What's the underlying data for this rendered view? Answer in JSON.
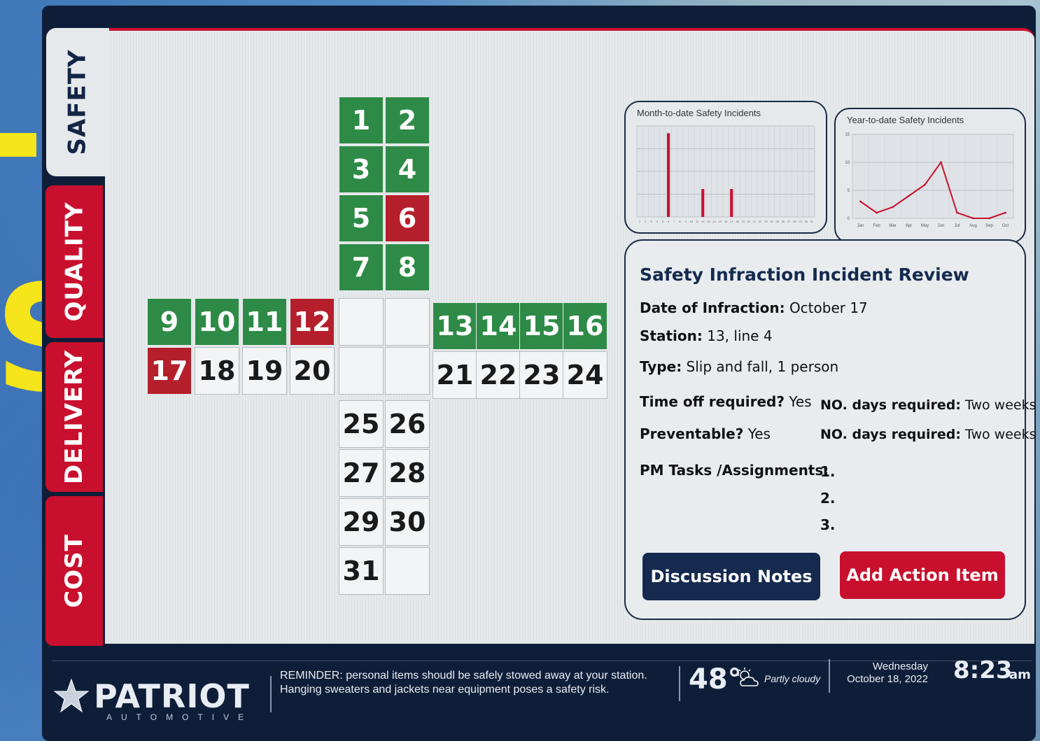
{
  "tabs": [
    {
      "label": "SAFETY",
      "active": true
    },
    {
      "label": "QUALITY",
      "active": false
    },
    {
      "label": "DELIVERY",
      "active": false
    },
    {
      "label": "COST",
      "active": false
    }
  ],
  "overlay": {
    "letter": "S"
  },
  "calendar": {
    "days": [
      {
        "n": "1",
        "status": "green"
      },
      {
        "n": "2",
        "status": "green"
      },
      {
        "n": "3",
        "status": "green"
      },
      {
        "n": "4",
        "status": "green"
      },
      {
        "n": "5",
        "status": "green"
      },
      {
        "n": "6",
        "status": "red"
      },
      {
        "n": "7",
        "status": "green"
      },
      {
        "n": "8",
        "status": "green"
      },
      {
        "n": "9",
        "status": "green"
      },
      {
        "n": "10",
        "status": "green"
      },
      {
        "n": "11",
        "status": "green"
      },
      {
        "n": "12",
        "status": "red"
      },
      {
        "n": "13",
        "status": "green"
      },
      {
        "n": "14",
        "status": "green"
      },
      {
        "n": "15",
        "status": "green"
      },
      {
        "n": "16",
        "status": "green"
      },
      {
        "n": "17",
        "status": "red"
      },
      {
        "n": "18",
        "status": "none"
      },
      {
        "n": "19",
        "status": "none"
      },
      {
        "n": "20",
        "status": "none"
      },
      {
        "n": "21",
        "status": "none"
      },
      {
        "n": "22",
        "status": "none"
      },
      {
        "n": "23",
        "status": "none"
      },
      {
        "n": "24",
        "status": "none"
      },
      {
        "n": "25",
        "status": "none"
      },
      {
        "n": "26",
        "status": "none"
      },
      {
        "n": "27",
        "status": "none"
      },
      {
        "n": "28",
        "status": "none"
      },
      {
        "n": "29",
        "status": "none"
      },
      {
        "n": "30",
        "status": "none"
      },
      {
        "n": "31",
        "status": "none"
      }
    ],
    "colors": {
      "green": "#2e8b47",
      "red": "#b51f2c",
      "none": "#f3f4f5"
    }
  },
  "chart_data": [
    {
      "type": "bar",
      "title": "Month-to-date Safety Incidents",
      "categories": [
        "1",
        "2",
        "3",
        "4",
        "5",
        "6",
        "7",
        "8",
        "9",
        "10",
        "11",
        "12",
        "13",
        "14",
        "15",
        "16",
        "17",
        "18",
        "19",
        "20",
        "21",
        "22",
        "23",
        "24",
        "25",
        "26",
        "27",
        "28",
        "29",
        "30",
        "31"
      ],
      "values": [
        0,
        0,
        0,
        0,
        0,
        3,
        0,
        0,
        0,
        0,
        0,
        1,
        0,
        0,
        0,
        0,
        1,
        0,
        0,
        0,
        0,
        0,
        0,
        0,
        0,
        0,
        0,
        0,
        0,
        0,
        0
      ],
      "ylim": [
        0,
        3
      ],
      "color": "#c8102e",
      "grid": true
    },
    {
      "type": "line",
      "title": "Year-to-date Safety Incidents",
      "categories": [
        "Jan",
        "Feb",
        "Mar",
        "Apr",
        "May",
        "Jun",
        "Jul",
        "Aug",
        "Sep",
        "Oct"
      ],
      "values": [
        3,
        1,
        2,
        4,
        6,
        10,
        1,
        0,
        0,
        1
      ],
      "yticks": [
        "0",
        "5",
        "10",
        "15"
      ],
      "ylim": [
        0,
        15
      ],
      "color": "#c8102e",
      "grid": true
    }
  ],
  "review": {
    "title": "Safety Infraction Incident Review",
    "date_label": "Date of Infraction:",
    "date_value": "October 17",
    "station_label": "Station:",
    "station_value": "13, line 4",
    "type_label": "Type:",
    "type_value": "Slip and fall, 1 person",
    "timeoff_label": "Time off required?",
    "timeoff_value": "Yes",
    "days1_label": "NO. days required:",
    "days1_value": "Two weeks",
    "prev_label": "Preventable?",
    "prev_value": "Yes",
    "days2_label": "NO. days required:",
    "days2_value": "Two weeks",
    "tasks_label": "PM Tasks /Assignments:",
    "tasks": [
      "1.",
      "2.",
      "3."
    ],
    "btn_notes": "Discussion Notes",
    "btn_action": "Add Action Item"
  },
  "footer": {
    "brand": "PATRIOT",
    "brand_sub": "AUTOMOTIVE",
    "reminder": "REMINDER: personal items shoudl be safely stowed away at your station. Hanging sweaters and jackets near equipment poses a safety risk.",
    "temperature": "48°",
    "weather_icon": "partly-cloudy-icon",
    "weather": "Partly cloudy",
    "day": "Wednesday",
    "date": "October 18, 2022",
    "time": "8:23",
    "ampm": "am"
  }
}
